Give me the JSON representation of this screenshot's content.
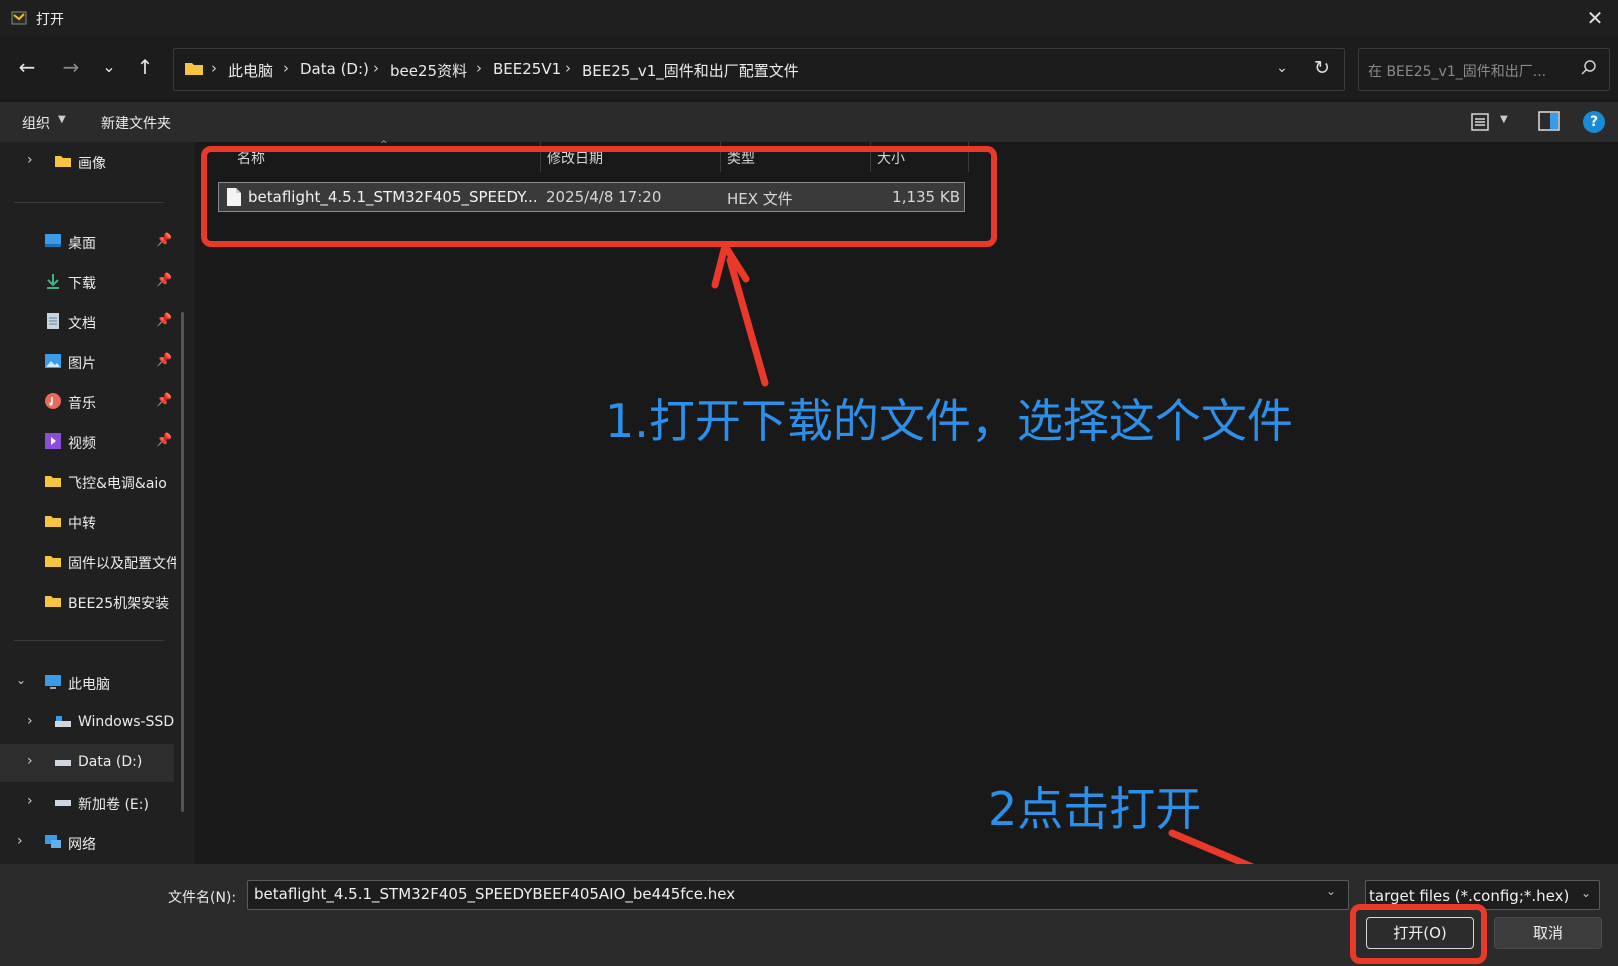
{
  "window": {
    "title": "打开"
  },
  "nav": {
    "back": "←",
    "forward": "→",
    "recent": "⌄",
    "up": "↑",
    "breadcrumbs": [
      "此电脑",
      "Data (D:)",
      "bee25资料",
      "BEE25V1",
      "BEE25_v1_固件和出厂配置文件"
    ],
    "separator": "›",
    "search_placeholder": "在 BEE25_v1_固件和出厂..."
  },
  "toolbar": {
    "organize": "组织",
    "new_folder": "新建文件夹"
  },
  "sidebar": {
    "items": [
      {
        "label": "画像",
        "icon": "folder-icon"
      },
      {
        "label": "桌面",
        "icon": "desktop-icon",
        "pinned": true
      },
      {
        "label": "下载",
        "icon": "download-icon",
        "pinned": true
      },
      {
        "label": "文档",
        "icon": "document-icon",
        "pinned": true
      },
      {
        "label": "图片",
        "icon": "pictures-icon",
        "pinned": true
      },
      {
        "label": "音乐",
        "icon": "music-icon",
        "pinned": true
      },
      {
        "label": "视频",
        "icon": "video-icon",
        "pinned": true
      },
      {
        "label": "飞控&电调&aio",
        "icon": "folder-icon"
      },
      {
        "label": "中转",
        "icon": "folder-icon"
      },
      {
        "label": "固件以及配置文件",
        "icon": "folder-icon"
      },
      {
        "label": "BEE25机架安装",
        "icon": "folder-icon"
      },
      {
        "label": "此电脑",
        "icon": "pc-icon"
      },
      {
        "label": "Windows-SSD",
        "icon": "drive-icon"
      },
      {
        "label": "Data (D:)",
        "icon": "drive-icon"
      },
      {
        "label": "新加卷 (E:)",
        "icon": "drive-icon"
      },
      {
        "label": "网络",
        "icon": "network-icon"
      }
    ]
  },
  "columns": {
    "name": "名称",
    "modified": "修改日期",
    "type": "类型",
    "size": "大小"
  },
  "files": [
    {
      "name": "betaflight_4.5.1_STM32F405_SPEEDY...",
      "modified": "2025/4/8 17:20",
      "type": "HEX 文件",
      "size": "1,135 KB"
    }
  ],
  "annotations": {
    "step1": "1.打开下载的文件，选择这个文件",
    "step2": "2点击打开",
    "color": "#e8392a",
    "text_color": "#2e8fe8"
  },
  "bottom": {
    "filename_label": "文件名(N):",
    "filename_value": "betaflight_4.5.1_STM32F405_SPEEDYBEEF405AIO_be445fce.hex",
    "filter": "target files (*.config;*.hex)",
    "open": "打开(O)",
    "cancel": "取消"
  }
}
